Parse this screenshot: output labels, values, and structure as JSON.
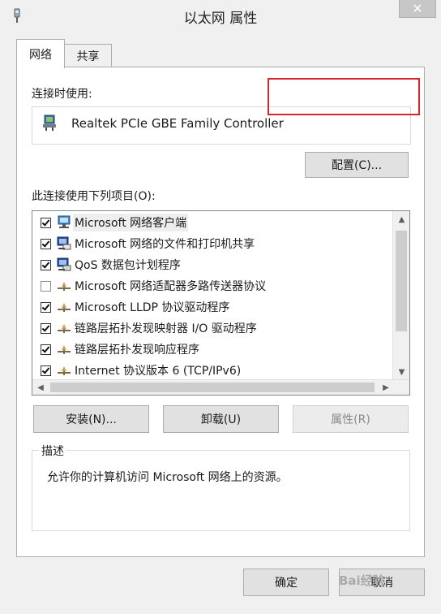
{
  "window": {
    "title": "以太网 属性",
    "close_glyph": "✕"
  },
  "tabs": [
    {
      "label": "网络",
      "active": true
    },
    {
      "label": "共享",
      "active": false
    }
  ],
  "connect_using": {
    "label": "连接时使用:",
    "adapter_name": "Realtek PCIe GBE Family Controller",
    "configure_button": "配置(C)..."
  },
  "items_section": {
    "label": "此连接使用下列项目(O):",
    "items": [
      {
        "label": "Microsoft 网络客户端",
        "checked": true,
        "icon": "network-client-icon",
        "selected": true
      },
      {
        "label": "Microsoft 网络的文件和打印机共享",
        "checked": true,
        "icon": "file-printer-share-icon",
        "selected": false
      },
      {
        "label": "QoS 数据包计划程序",
        "checked": true,
        "icon": "qos-scheduler-icon",
        "selected": false
      },
      {
        "label": "Microsoft 网络适配器多路传送器协议",
        "checked": false,
        "icon": "protocol-icon",
        "selected": false
      },
      {
        "label": "Microsoft LLDP 协议驱动程序",
        "checked": true,
        "icon": "protocol-icon",
        "selected": false
      },
      {
        "label": "链路层拓扑发现映射器 I/O 驱动程序",
        "checked": true,
        "icon": "protocol-icon",
        "selected": false
      },
      {
        "label": "链路层拓扑发现响应程序",
        "checked": true,
        "icon": "protocol-icon",
        "selected": false
      },
      {
        "label": "Internet 协议版本 6 (TCP/IPv6)",
        "checked": true,
        "icon": "protocol-icon",
        "selected": false
      }
    ]
  },
  "actions": {
    "install": "安装(N)...",
    "uninstall": "卸载(U)",
    "properties": "属性(R)"
  },
  "description": {
    "legend": "描述",
    "text": "允许你的计算机访问 Microsoft 网络上的资源。"
  },
  "footer": {
    "ok": "确定",
    "cancel": "取消"
  },
  "watermark": "Bai经验",
  "colors": {
    "highlight_box": "#d8262c",
    "selected_row": "#eeeeee"
  }
}
